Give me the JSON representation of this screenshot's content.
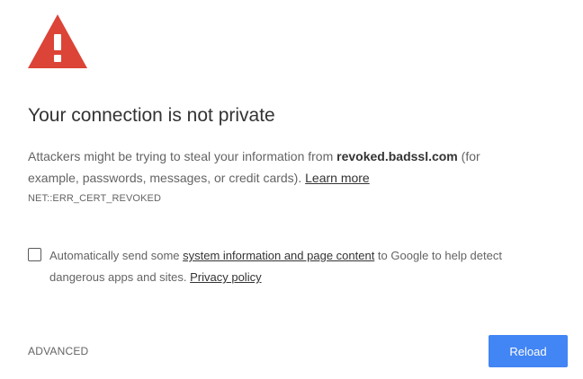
{
  "icon": {
    "name": "warning-triangle-icon",
    "color": "#db4437"
  },
  "title": "Your connection is not private",
  "description": {
    "before_host": "Attackers might be trying to steal your information from ",
    "host": "revoked.badssl.com",
    "after_host": " (for example, passwords, messages, or credit cards). ",
    "learn_more": "Learn more"
  },
  "error_code": "NET::ERR_CERT_REVOKED",
  "optin": {
    "before_link": "Automatically send some ",
    "link": "system information and page content",
    "after_link": " to Google to help detect dangerous apps and sites. ",
    "privacy_link": "Privacy policy",
    "checked": false
  },
  "buttons": {
    "advanced": "ADVANCED",
    "reload": "Reload"
  },
  "colors": {
    "accent": "#4285f4",
    "error_red": "#db4437"
  }
}
